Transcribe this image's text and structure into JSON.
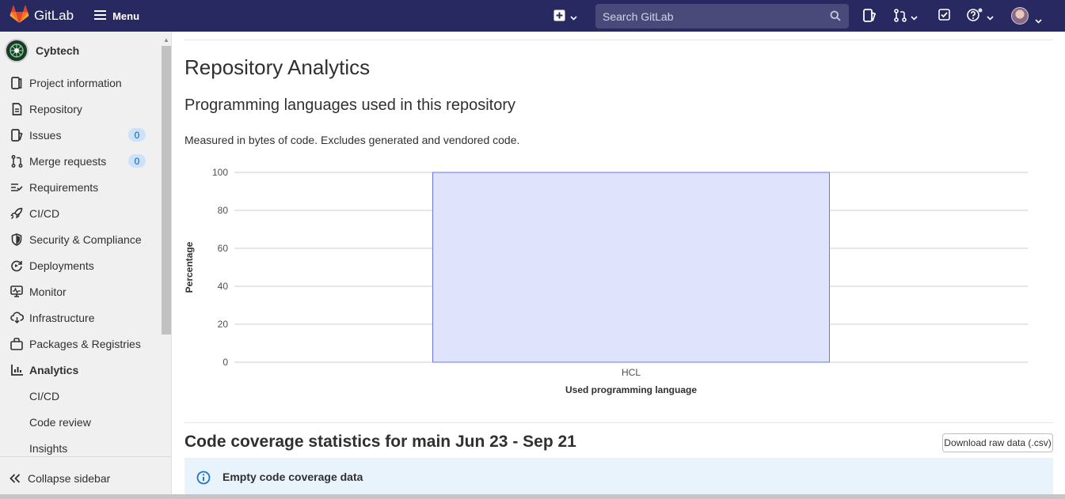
{
  "topbar": {
    "brand": "GitLab",
    "menu_label": "Menu",
    "search_placeholder": "Search GitLab"
  },
  "sidebar": {
    "project_name": "Cybtech",
    "items": [
      {
        "label": "Project information",
        "icon": "project-information-icon"
      },
      {
        "label": "Repository",
        "icon": "repository-icon"
      },
      {
        "label": "Issues",
        "icon": "issues-icon",
        "badge": "0"
      },
      {
        "label": "Merge requests",
        "icon": "merge-request-icon",
        "badge": "0"
      },
      {
        "label": "Requirements",
        "icon": "requirements-icon"
      },
      {
        "label": "CI/CD",
        "icon": "rocket-icon"
      },
      {
        "label": "Security & Compliance",
        "icon": "shield-icon"
      },
      {
        "label": "Deployments",
        "icon": "deployments-icon"
      },
      {
        "label": "Monitor",
        "icon": "monitor-icon"
      },
      {
        "label": "Infrastructure",
        "icon": "cloud-icon"
      },
      {
        "label": "Packages & Registries",
        "icon": "package-icon"
      },
      {
        "label": "Analytics",
        "icon": "analytics-icon",
        "active": true
      }
    ],
    "subitems": [
      "CI/CD",
      "Code review",
      "Insights"
    ],
    "collapse_label": "Collapse sidebar"
  },
  "main": {
    "title": "Repository Analytics",
    "languages_heading": "Programming languages used in this repository",
    "languages_description": "Measured in bytes of code. Excludes generated and vendored code.",
    "coverage_heading_prefix": "Code coverage statistics for ",
    "coverage_branch": "main",
    "coverage_range": " Jun 23 - Sep 21",
    "download_label": "Download raw data (.csv)",
    "alert_title": "Empty code coverage data"
  },
  "colors": {
    "topbar": "#292961",
    "bar_fill": "#dfe3fb",
    "bar_stroke": "#6479e6",
    "alert_bg": "#e9f3fc",
    "badge_bg": "#cbe2f9"
  },
  "chart_data": {
    "type": "bar",
    "categories": [
      "HCL"
    ],
    "values": [
      100
    ],
    "xlabel": "Used programming language",
    "ylabel": "Percentage",
    "ylim": [
      0,
      100
    ],
    "yticks": [
      "0",
      "20",
      "40",
      "60",
      "80",
      "100"
    ],
    "grid": true
  }
}
